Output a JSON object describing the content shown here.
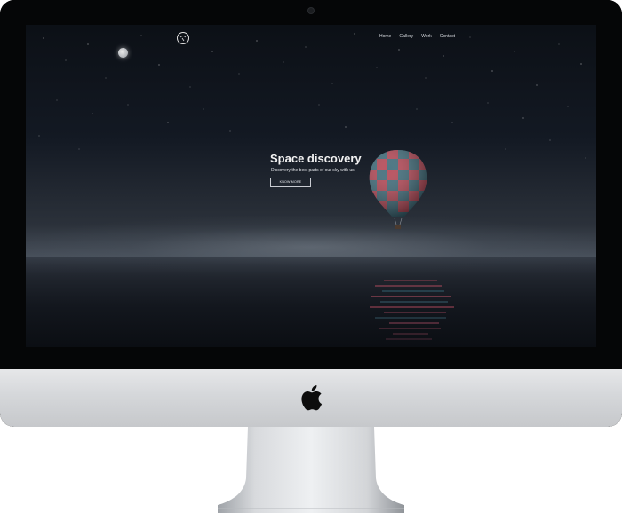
{
  "site": {
    "nav": [
      "Home",
      "Gallery",
      "Work",
      "Contact"
    ],
    "hero": {
      "title": "Space discovery",
      "subtitle": "Discovery the best parts of our sky with us.",
      "button": "KNOW MORE"
    }
  },
  "device": {
    "logo_icon": "apple-logo-icon",
    "colors": {
      "bezel": "#050607",
      "chin": "#d5d7da",
      "sky_top": "#0c1016",
      "balloon_red": "#b03848",
      "balloon_teal": "#2f6070"
    }
  }
}
